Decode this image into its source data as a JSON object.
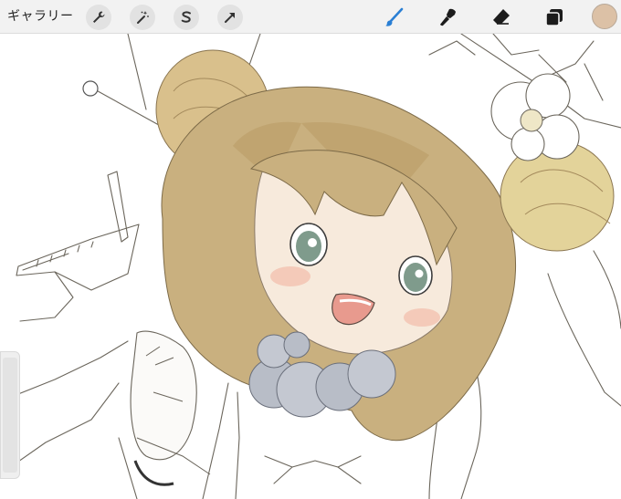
{
  "toolbar": {
    "gallery_label": "ギャラリー",
    "actions": [
      {
        "name": "wrench-icon"
      },
      {
        "name": "magic-wand-icon"
      },
      {
        "name": "selection-icon"
      },
      {
        "name": "transform-arrow-icon"
      }
    ],
    "tools": [
      {
        "name": "brush-icon",
        "active": true
      },
      {
        "name": "smudge-icon",
        "active": false
      },
      {
        "name": "eraser-icon",
        "active": false
      },
      {
        "name": "layers-icon",
        "active": false
      }
    ],
    "current_color": "#dcc1a6",
    "active_color": "#2a7fd4"
  },
  "canvas": {
    "artwork": "illustration"
  }
}
